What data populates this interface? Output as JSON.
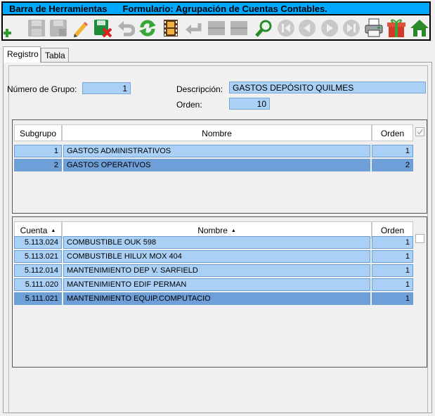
{
  "window": {
    "toolbar_title": "Barra de Herramientas",
    "form_title": "Formulario: Agrupación de Cuentas Contables."
  },
  "toolbar": {
    "buttons": [
      {
        "icon": "add-icon",
        "enabled": true
      },
      {
        "icon": "save-icon",
        "enabled": false
      },
      {
        "icon": "save-as-icon",
        "enabled": false
      },
      {
        "icon": "edit-pencil-icon",
        "enabled": true
      },
      {
        "icon": "delete-save-icon",
        "enabled": true
      },
      {
        "icon": "undo-icon",
        "enabled": false
      },
      {
        "icon": "refresh-icon",
        "enabled": true
      },
      {
        "icon": "film-icon",
        "enabled": true
      },
      {
        "icon": "return-arrow-icon",
        "enabled": false
      },
      {
        "icon": "blank-icon",
        "enabled": false
      },
      {
        "icon": "blank-icon",
        "enabled": false
      },
      {
        "icon": "search-icon",
        "enabled": true
      },
      {
        "icon": "first-record-icon",
        "enabled": false
      },
      {
        "icon": "previous-record-icon",
        "enabled": false
      },
      {
        "icon": "next-record-icon",
        "enabled": false
      },
      {
        "icon": "last-record-icon",
        "enabled": false
      },
      {
        "icon": "printer-icon",
        "enabled": true
      },
      {
        "icon": "gift-icon",
        "enabled": true
      },
      {
        "icon": "home-icon",
        "enabled": true
      }
    ]
  },
  "tabs": [
    {
      "label": "Registro",
      "active": true
    },
    {
      "label": "Tabla",
      "active": false
    }
  ],
  "form": {
    "numero_grupo_label": "Número de Grupo:",
    "numero_grupo_value": "1",
    "descripcion_label": "Descripción:",
    "descripcion_value": "GASTOS DEPÓSITO QUILMES",
    "orden_label": "Orden:",
    "orden_value": "10"
  },
  "subgrupos": {
    "headers": {
      "subgrupo": "Subgrupo",
      "nombre": "Nombre",
      "orden": "Orden"
    },
    "rows": [
      {
        "subgrupo": "1",
        "nombre": "GASTOS ADMINISTRATIVOS",
        "orden": "1",
        "selected": false
      },
      {
        "subgrupo": "2",
        "nombre": "GASTOS OPERATIVOS",
        "orden": "2",
        "selected": true
      }
    ]
  },
  "cuentas": {
    "headers": {
      "cuenta": "Cuenta",
      "nombre": "Nombre",
      "orden": "Orden"
    },
    "rows": [
      {
        "cuenta": "5.113.024",
        "nombre": "COMBUSTIBLE OUK 598",
        "orden": "1",
        "selected": false
      },
      {
        "cuenta": "5.113.021",
        "nombre": "COMBUSTIBLE HILUX MOX 404",
        "orden": "1",
        "selected": false
      },
      {
        "cuenta": "5.112.014",
        "nombre": "MANTENIMIENTO DEP V. SARFIELD",
        "orden": "1",
        "selected": false
      },
      {
        "cuenta": "5.111.020",
        "nombre": "MANTENIMIENTO EDIF PERMAN",
        "orden": "1",
        "selected": false
      },
      {
        "cuenta": "5.111.021",
        "nombre": "MANTENIMIENTO EQUIP.COMPUTACIO",
        "orden": "1",
        "selected": true
      }
    ]
  },
  "colors": {
    "title_bar": "#00a8ff",
    "field_bg": "#aad1f5",
    "row_selected": "#6f9fd8"
  }
}
